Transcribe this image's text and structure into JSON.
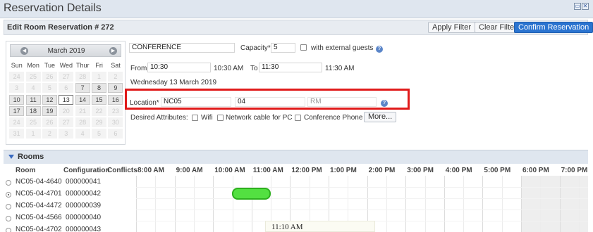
{
  "window": {
    "title": "Reservation Details",
    "min_glyph": "▭",
    "close_glyph": "✕"
  },
  "header": {
    "title": "Edit Room Reservation # 272",
    "apply_filter": "Apply Filter",
    "clear_filter": "Clear Filter",
    "confirm": "Confirm Reservation"
  },
  "calendar": {
    "month": "March 2019",
    "prev_icon": "◀",
    "next_icon": "▶",
    "dow": [
      "Sun",
      "Mon",
      "Tue",
      "Wed",
      "Thur",
      "Fri",
      "Sat"
    ],
    "weeks": [
      [
        {
          "d": "24",
          "s": "off"
        },
        {
          "d": "25",
          "s": "off"
        },
        {
          "d": "26",
          "s": "off"
        },
        {
          "d": "27",
          "s": "off"
        },
        {
          "d": "28",
          "s": "off"
        },
        {
          "d": "1",
          "s": "off"
        },
        {
          "d": "2",
          "s": "off"
        }
      ],
      [
        {
          "d": "3",
          "s": "off"
        },
        {
          "d": "4",
          "s": "off"
        },
        {
          "d": "5",
          "s": "off"
        },
        {
          "d": "6",
          "s": "off"
        },
        {
          "d": "7",
          "s": "cur"
        },
        {
          "d": "8",
          "s": "cur"
        },
        {
          "d": "9",
          "s": "cur"
        }
      ],
      [
        {
          "d": "10",
          "s": "cur"
        },
        {
          "d": "11",
          "s": "cur"
        },
        {
          "d": "12",
          "s": "cur"
        },
        {
          "d": "13",
          "s": "sel"
        },
        {
          "d": "14",
          "s": "cur"
        },
        {
          "d": "15",
          "s": "cur"
        },
        {
          "d": "16",
          "s": "cur"
        }
      ],
      [
        {
          "d": "17",
          "s": "cur"
        },
        {
          "d": "18",
          "s": "cur"
        },
        {
          "d": "19",
          "s": "cur"
        },
        {
          "d": "20",
          "s": "off"
        },
        {
          "d": "21",
          "s": "off"
        },
        {
          "d": "22",
          "s": "off"
        },
        {
          "d": "23",
          "s": "off"
        }
      ],
      [
        {
          "d": "24",
          "s": "off"
        },
        {
          "d": "25",
          "s": "off"
        },
        {
          "d": "26",
          "s": "off"
        },
        {
          "d": "27",
          "s": "off"
        },
        {
          "d": "28",
          "s": "off"
        },
        {
          "d": "29",
          "s": "off"
        },
        {
          "d": "30",
          "s": "off"
        }
      ],
      [
        {
          "d": "31",
          "s": "off"
        },
        {
          "d": "1",
          "s": "off"
        },
        {
          "d": "2",
          "s": "off"
        },
        {
          "d": "3",
          "s": "off"
        },
        {
          "d": "4",
          "s": "off"
        },
        {
          "d": "5",
          "s": "off"
        },
        {
          "d": "6",
          "s": "off"
        }
      ]
    ]
  },
  "form": {
    "name_value": "CONFERENCE",
    "capacity_label": "Capacity*",
    "capacity_value": "5",
    "external_guests_label": "with external guests",
    "from_label": "From",
    "from_value": "10:30",
    "from_display": "10:30 AM",
    "to_label": "To",
    "to_value": "11:30",
    "to_display": "11:30 AM",
    "date_text": "Wednesday 13 March 2019",
    "location_label": "Location*",
    "location_building": "NC05",
    "location_floor": "04",
    "location_rm_placeholder": "RM",
    "desired_label": "Desired Attributes:",
    "attributes": [
      "Wifi",
      "Network cable for PC",
      "Conference Phone"
    ],
    "more_button": "More...",
    "info_glyph": "?"
  },
  "rooms": {
    "section_title": "Rooms",
    "columns": [
      "Room",
      "Configuration",
      "Conflicts"
    ],
    "hours": [
      "8:00 AM",
      "9:00 AM",
      "10:00 AM",
      "11:00 AM",
      "12:00 PM",
      "1:00 PM",
      "2:00 PM",
      "3:00 PM",
      "4:00 PM",
      "5:00 PM",
      "6:00 PM",
      "7:00 PM"
    ],
    "rows": [
      {
        "room": "NC05-04-4640",
        "config": "000000041",
        "selected": false
      },
      {
        "room": "NC05-04-4701",
        "config": "000000042",
        "selected": true
      },
      {
        "room": "NC05-04-4472",
        "config": "000000039",
        "selected": false
      },
      {
        "room": "NC05-04-4566",
        "config": "000000040",
        "selected": false
      },
      {
        "room": "NC05-04-4702",
        "config": "000000043",
        "selected": false
      }
    ],
    "tooltip_time": "11:10 AM"
  }
}
